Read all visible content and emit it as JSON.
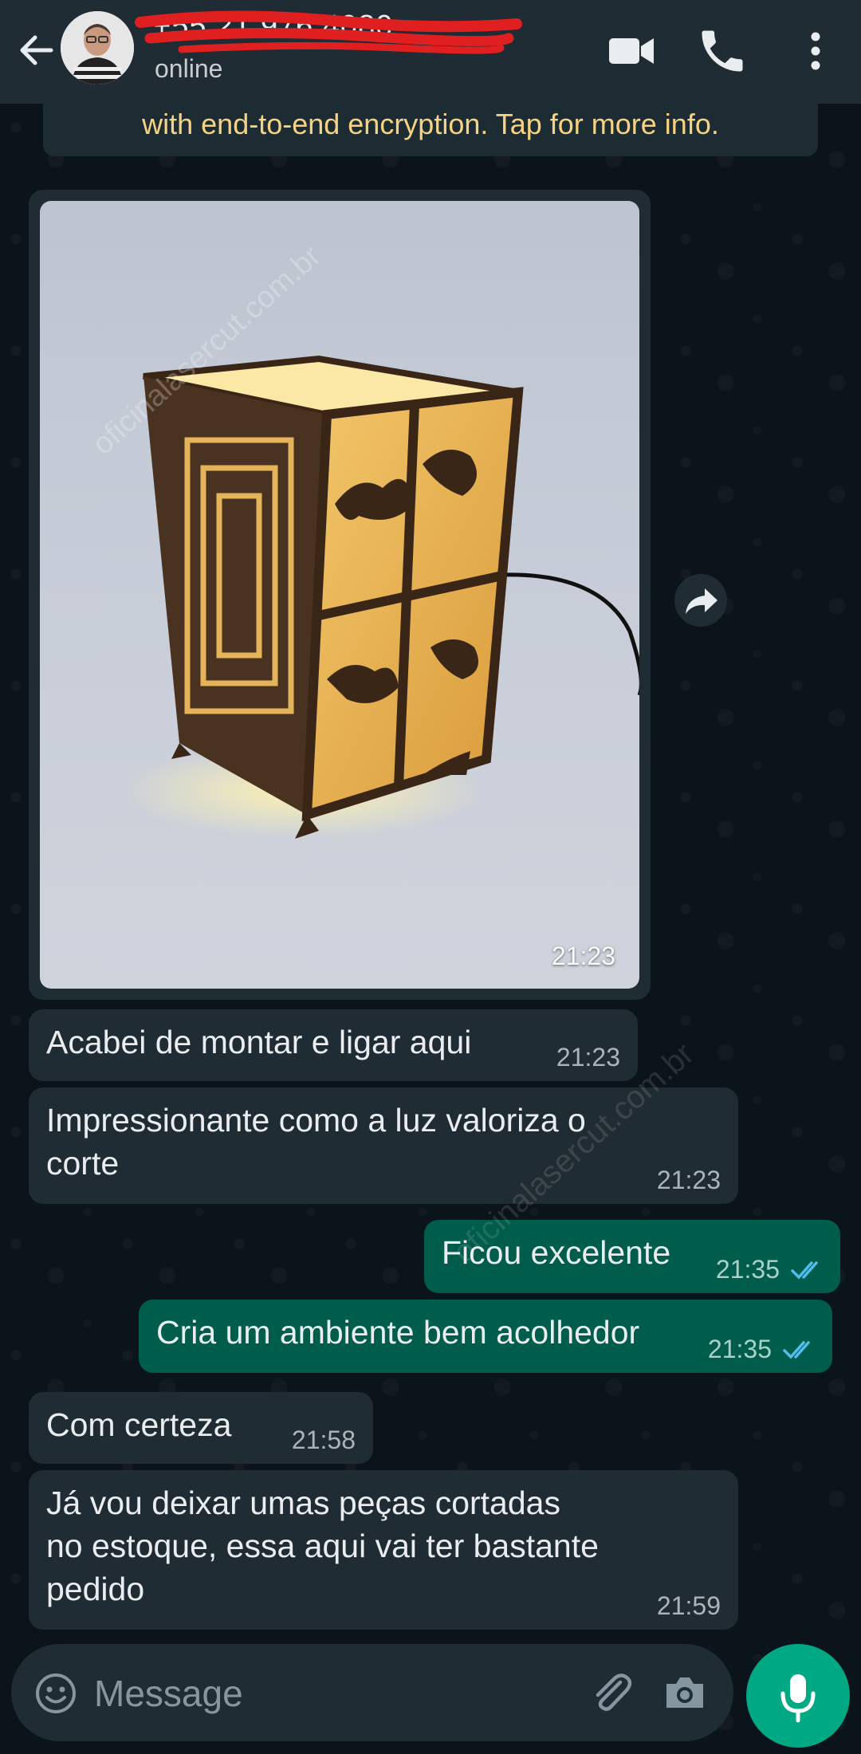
{
  "header": {
    "contact_name": "+55 21 976 4080",
    "status": "online",
    "icons": [
      "back-arrow-icon",
      "video-call-icon",
      "voice-call-icon",
      "more-options-icon"
    ]
  },
  "encryption_notice": "with end-to-end encryption. Tap for more info.",
  "messages": [
    {
      "direction": "in",
      "type": "image",
      "time": "21:23"
    },
    {
      "direction": "in",
      "text": "Acabei de montar e ligar aqui",
      "time": "21:23"
    },
    {
      "direction": "in",
      "text": "Impressionante como a luz valoriza o\ncorte",
      "time": "21:23"
    },
    {
      "direction": "out",
      "text": "Ficou excelente",
      "time": "21:35",
      "read": true
    },
    {
      "direction": "out",
      "text": "Cria um ambiente bem acolhedor",
      "time": "21:35",
      "read": true
    },
    {
      "direction": "in",
      "text": "Com certeza",
      "time": "21:58"
    },
    {
      "direction": "in",
      "text": "Já vou deixar umas peças cortadas\nno estoque, essa aqui vai ter bastante\npedido",
      "time": "21:59"
    }
  ],
  "watermark": "oficinalasercut.com.br",
  "composer": {
    "placeholder": "Message",
    "icons": [
      "emoji-icon",
      "attach-icon",
      "camera-icon",
      "mic-icon"
    ]
  },
  "colors": {
    "background": "#0b141a",
    "header": "#1f2c34",
    "incoming_bubble": "#202c33",
    "outgoing_bubble": "#005c4b",
    "accent": "#00a884",
    "read_ticks": "#53bdeb",
    "encryption_text": "#f5d383"
  }
}
